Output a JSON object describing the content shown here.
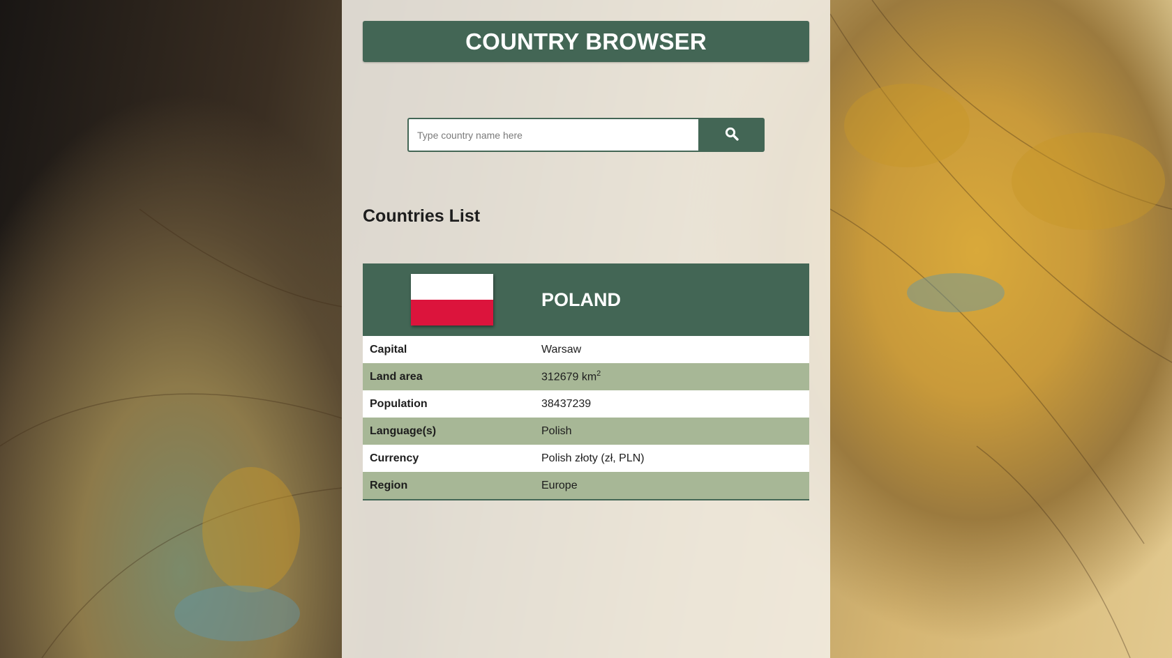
{
  "header": {
    "title": "COUNTRY BROWSER"
  },
  "search": {
    "placeholder": "Type country name here",
    "value": "",
    "button_icon": "search-icon"
  },
  "list": {
    "heading": "Countries List"
  },
  "country": {
    "name": "POLAND",
    "flag_colors": [
      "#ffffff",
      "#dc143c"
    ],
    "rows": [
      {
        "label": "Capital",
        "value": "Warsaw"
      },
      {
        "label": "Land area",
        "value": "312679 km",
        "sup": "2"
      },
      {
        "label": "Population",
        "value": "38437239"
      },
      {
        "label": "Language(s)",
        "value": "Polish"
      },
      {
        "label": "Currency",
        "value": "Polish złoty (zł, PLN)"
      },
      {
        "label": "Region",
        "value": "Europe"
      }
    ]
  },
  "colors": {
    "primary": "#436655",
    "row_alt": "#a7b796"
  }
}
